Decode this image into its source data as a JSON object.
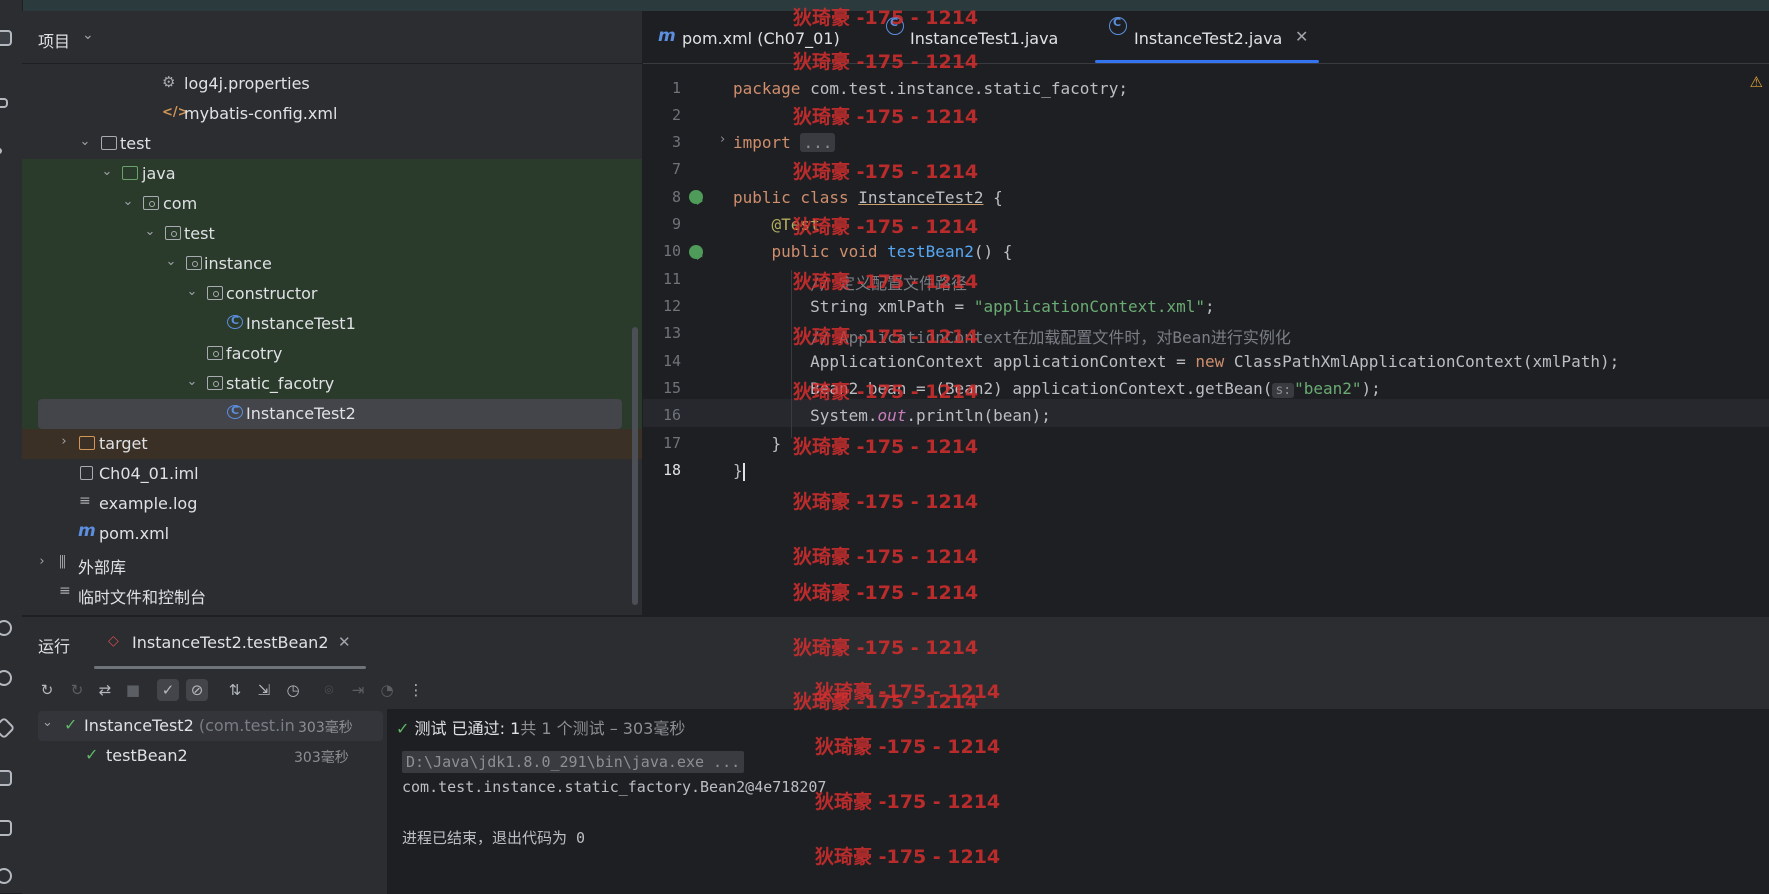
{
  "project": {
    "title": "项目",
    "items": [
      {
        "label": "log4j.properties",
        "icon": "gear-icon"
      },
      {
        "label": "mybatis-config.xml",
        "icon": "xml-icon"
      },
      {
        "label": "test",
        "icon": "folder-icon"
      },
      {
        "label": "java",
        "icon": "source-folder-icon"
      },
      {
        "label": "com",
        "icon": "package-icon"
      },
      {
        "label": "test",
        "icon": "package-icon"
      },
      {
        "label": "instance",
        "icon": "package-icon"
      },
      {
        "label": "constructor",
        "icon": "package-icon"
      },
      {
        "label": "InstanceTest1",
        "icon": "class-icon"
      },
      {
        "label": "facotry",
        "icon": "package-icon"
      },
      {
        "label": "static_facotry",
        "icon": "package-icon"
      },
      {
        "label": "InstanceTest2",
        "icon": "class-icon"
      },
      {
        "label": "target",
        "icon": "folder-icon"
      },
      {
        "label": "Ch04_01.iml",
        "icon": "file-icon"
      },
      {
        "label": "example.log",
        "icon": "log-icon"
      },
      {
        "label": "pom.xml",
        "icon": "maven-icon"
      },
      {
        "label": "外部库",
        "icon": "library-icon"
      },
      {
        "label": "临时文件和控制台",
        "icon": "scratch-icon"
      }
    ]
  },
  "editor": {
    "tabs": [
      {
        "label": "pom.xml (Ch07_01)",
        "icon": "maven-icon"
      },
      {
        "label": "InstanceTest1.java",
        "icon": "class-icon"
      },
      {
        "label": "InstanceTest2.java",
        "icon": "class-icon",
        "active": true
      }
    ],
    "line_numbers": [
      "1",
      "2",
      "3",
      "7",
      "8",
      "9",
      "10",
      "11",
      "12",
      "13",
      "14",
      "15",
      "16",
      "17",
      "18"
    ],
    "code": {
      "l1_kw": "package",
      "l1_rest": " com.test.instance.static_facotry;",
      "l3_kw": "import",
      "l3_fold": "...",
      "l8_kw": "public class",
      "l8_name": "InstanceTest2",
      "l8_rest": " {",
      "l9_ann": "@Test",
      "l10_kw": "public void",
      "l10_fn": "testBean2",
      "l10_rest": "() {",
      "l11_cmt": "// 定义配置文件路径",
      "l12_pre": "String xmlPath = ",
      "l12_str": "\"applicationContext.xml\"",
      "l12_post": ";",
      "l13_cmt": "// ApplicationContext在加载配置文件时，对Bean进行实例化",
      "l14_pre": "ApplicationContext applicationContext = ",
      "l14_kw": "new",
      "l14_post": " ClassPathXmlApplicationContext(xmlPath);",
      "l15_pre": "Bean2 bean = (Bean2) applicationContext.getBean(",
      "l15_hint": "s:",
      "l15_str": "\"bean2\"",
      "l15_post": ");",
      "l16_pre": "System.",
      "l16_out": "out",
      "l16_post": ".println(bean);",
      "l17": "}",
      "l18": "}"
    },
    "watermark": "狄琦豪 -175 - 1214"
  },
  "run": {
    "title": "运行",
    "tab_label": "InstanceTest2.testBean2",
    "tree": [
      {
        "label": "InstanceTest2",
        "detail": "(com.test.inst",
        "time": "303毫秒"
      },
      {
        "label": "testBean2",
        "time": "303毫秒"
      }
    ],
    "status_prefix": "测试 已通过: ",
    "status_count": "1",
    "status_suffix": "共 1 个测试 – 303毫秒",
    "console": {
      "cmd": "D:\\Java\\jdk1.8.0_291\\bin\\java.exe ...",
      "output": "com.test.instance.static_factory.Bean2@4e718207",
      "exit": "进程已结束，退出代码为 0"
    }
  },
  "colors": {
    "accent": "#3574f0",
    "pass": "#5fb865",
    "watermark": "#d62e2e"
  }
}
